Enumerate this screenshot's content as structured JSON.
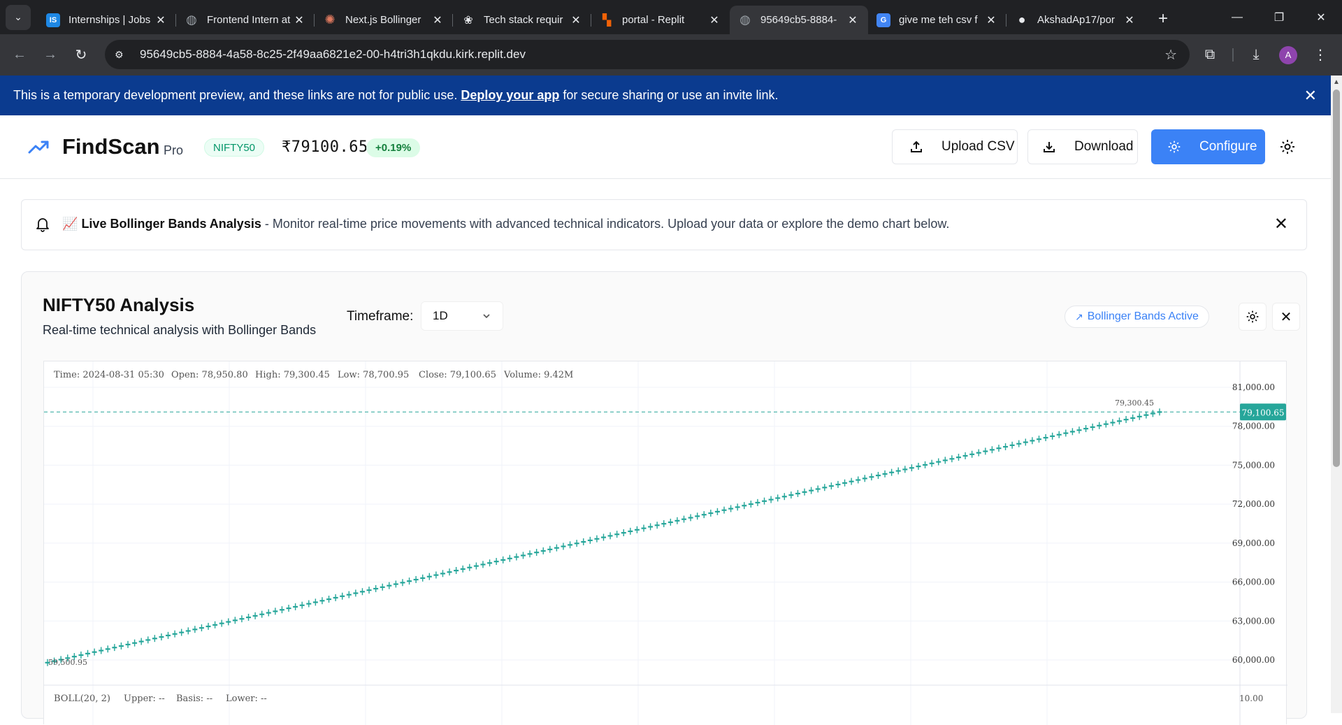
{
  "browser": {
    "tabs": [
      {
        "title": "Internships | Jobs",
        "favicon": "IS",
        "color": "#1e88e5"
      },
      {
        "title": "Frontend Intern at",
        "favicon": "globe",
        "color": "#9aa0a6"
      },
      {
        "title": "Next.js Bollinger",
        "favicon": "asterisk",
        "color": "#e07a5f"
      },
      {
        "title": "Tech stack requir",
        "favicon": "openai",
        "color": "#e8eaed"
      },
      {
        "title": "portal - Replit",
        "favicon": "replit",
        "color": "#f26207"
      },
      {
        "title": "95649cb5-8884-",
        "favicon": "globe",
        "color": "#9aa0a6",
        "active": true
      },
      {
        "title": "give me teh csv f",
        "favicon": "G",
        "color": "#4285f4"
      },
      {
        "title": "AkshadAp17/por",
        "favicon": "github",
        "color": "#e8eaed"
      }
    ],
    "url": "95649cb5-8884-4a58-8c25-2f49aa6821e2-00-h4tri3h1qkdu.kirk.replit.dev",
    "profile_initial": "A"
  },
  "banner": {
    "text_before": "This is a temporary development preview, and these links are not for public use.",
    "link": "Deploy your app",
    "text_after": "for secure sharing or use an invite link."
  },
  "header": {
    "brand": "FindScan",
    "brand_suffix": "Pro",
    "symbol": "NIFTY50",
    "price": "₹79100.65",
    "change": "+0.19%",
    "upload_label": "Upload CSV",
    "download_label": "Download",
    "configure_label": "Configure",
    "accent": "#3b82f6"
  },
  "notice": {
    "emoji": "📈",
    "title": "Live Bollinger Bands Analysis",
    "message": "- Monitor real-time price movements with advanced technical indicators. Upload your data or explore the demo chart below."
  },
  "card": {
    "title": "NIFTY50 Analysis",
    "subtitle": "Real-time technical analysis with Bollinger Bands",
    "timeframe_label": "Timeframe:",
    "timeframe_value": "1D",
    "bb_badge": "Bollinger Bands Active"
  },
  "chart_data": {
    "type": "candlestick",
    "ohlc_legend": {
      "time": "Time: 2024-08-31 05:30",
      "open": "Open: 78,950.80",
      "high": "High: 79,300.45",
      "low": "Low: 78,700.95",
      "close": "Close: 79,100.65",
      "volume": "Volume: 9.42M"
    },
    "y_ticks": [
      "81,000.00",
      "78,000.00",
      "75,000.00",
      "72,000.00",
      "69,000.00",
      "66,000.00",
      "63,000.00",
      "60,000.00"
    ],
    "y_tick_values": [
      81000,
      78000,
      75000,
      72000,
      69000,
      66000,
      63000,
      60000
    ],
    "last_price_label": "79,100.65",
    "last_price": 79100.65,
    "max_label": "79,300.45",
    "min_label": "59,500.95",
    "series": {
      "start_close": 59800,
      "end_close": 79100.65,
      "count": 167,
      "color": "#26a69a"
    },
    "indicator": {
      "label": "BOLL(20, 2)",
      "upper": "Upper: --",
      "basis": "Basis: --",
      "lower": "Lower: --",
      "pane_tick": "10.00"
    }
  }
}
